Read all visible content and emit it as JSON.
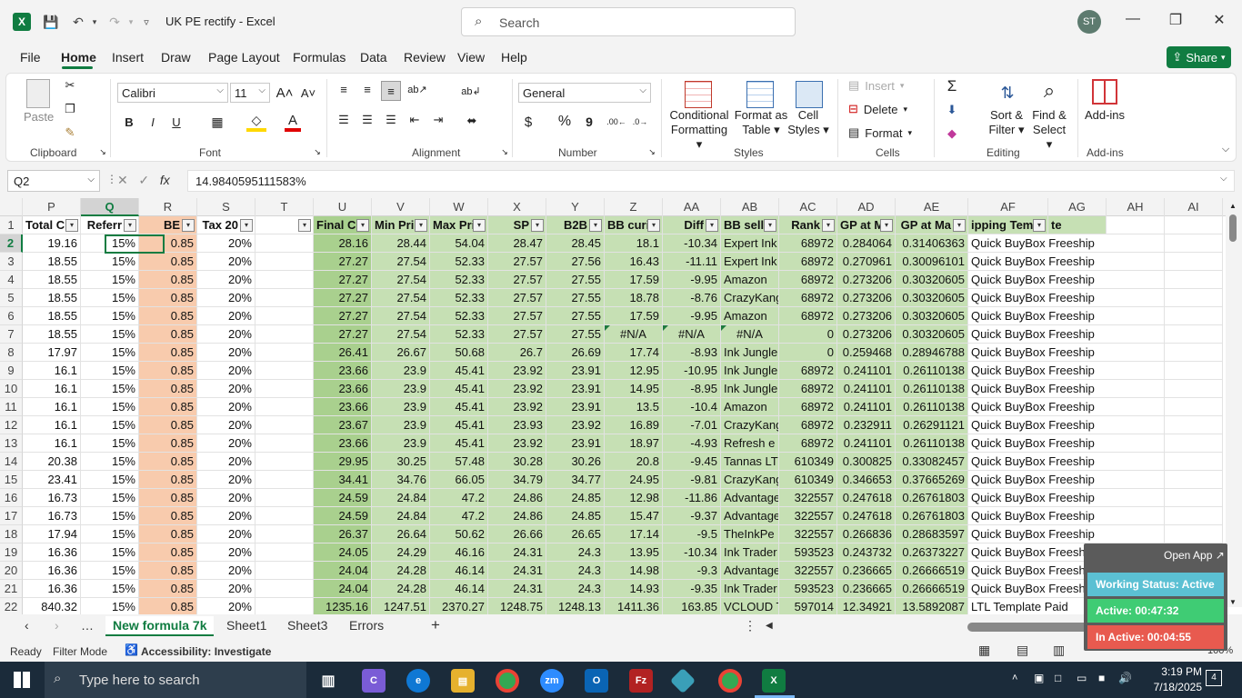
{
  "titlebar": {
    "doc_title": "UK PE rectify  -  Excel",
    "search_placeholder": "Search",
    "avatar": "ST"
  },
  "menu": [
    "File",
    "Home",
    "Insert",
    "Draw",
    "Page Layout",
    "Formulas",
    "Data",
    "Review",
    "View",
    "Help"
  ],
  "share_label": "Share",
  "ribbon": {
    "clipboard": {
      "label": "Clipboard",
      "paste": "Paste"
    },
    "font": {
      "label": "Font",
      "name": "Calibri",
      "size": "11",
      "bold": "B",
      "italic": "I",
      "underline": "U"
    },
    "alignment": {
      "label": "Alignment"
    },
    "number": {
      "label": "Number",
      "format": "General",
      "currency": "$",
      "percent": "%",
      "comma": "9"
    },
    "styles": {
      "label": "Styles",
      "conditional": "Conditional",
      "formatting": "Formatting",
      "format_as": "Format as",
      "table": "Table",
      "cell": "Cell",
      "styles": "Styles"
    },
    "cells": {
      "label": "Cells",
      "insert": "Insert",
      "delete": "Delete",
      "format": "Format"
    },
    "editing": {
      "label": "Editing",
      "sort": "Sort &",
      "filter": "Filter",
      "find": "Find &",
      "select": "Select"
    },
    "addins": {
      "label": "Add-ins",
      "addins": "Add-ins"
    }
  },
  "formula_bar": {
    "name_box": "Q2",
    "formula": "14.9840595111583%"
  },
  "columns": [
    "P",
    "Q",
    "R",
    "S",
    "T",
    "U",
    "V",
    "W",
    "X",
    "Y",
    "Z",
    "AA",
    "AB",
    "AC",
    "AD",
    "AE",
    "AF",
    "AG",
    "AH",
    "AI"
  ],
  "headers": [
    "Total C",
    "Referr",
    "BE",
    "Tax 20",
    "",
    "Final C",
    "Min Pri",
    "Max Pri",
    "SP",
    "B2B",
    "BB curi",
    "Diff",
    "BB sell",
    "Rank",
    "GP at M",
    "GP at Ma",
    "ipping Temp",
    "te",
    "",
    ""
  ],
  "rows": [
    {
      "n": "2",
      "v": [
        "19.16",
        "15%",
        "0.85",
        "20%",
        "",
        "28.16",
        "28.44",
        "54.04",
        "28.47",
        "28.45",
        "18.1",
        "-10.34",
        "Expert Ink",
        "68972",
        "0.284064",
        "0.31406363",
        "Quick BuyBox Freeship"
      ]
    },
    {
      "n": "3",
      "v": [
        "18.55",
        "15%",
        "0.85",
        "20%",
        "",
        "27.27",
        "27.54",
        "52.33",
        "27.57",
        "27.56",
        "16.43",
        "-11.11",
        "Expert Ink",
        "68972",
        "0.270961",
        "0.30096101",
        "Quick BuyBox Freeship"
      ]
    },
    {
      "n": "4",
      "v": [
        "18.55",
        "15%",
        "0.85",
        "20%",
        "",
        "27.27",
        "27.54",
        "52.33",
        "27.57",
        "27.55",
        "17.59",
        "-9.95",
        "Amazon",
        "68972",
        "0.273206",
        "0.30320605",
        "Quick BuyBox Freeship"
      ]
    },
    {
      "n": "5",
      "v": [
        "18.55",
        "15%",
        "0.85",
        "20%",
        "",
        "27.27",
        "27.54",
        "52.33",
        "27.57",
        "27.55",
        "18.78",
        "-8.76",
        "CrazyKang",
        "68972",
        "0.273206",
        "0.30320605",
        "Quick BuyBox Freeship"
      ]
    },
    {
      "n": "6",
      "v": [
        "18.55",
        "15%",
        "0.85",
        "20%",
        "",
        "27.27",
        "27.54",
        "52.33",
        "27.57",
        "27.55",
        "17.59",
        "-9.95",
        "Amazon",
        "68972",
        "0.273206",
        "0.30320605",
        "Quick BuyBox Freeship"
      ]
    },
    {
      "n": "7",
      "v": [
        "18.55",
        "15%",
        "0.85",
        "20%",
        "",
        "27.27",
        "27.54",
        "52.33",
        "27.57",
        "27.55",
        "#N/A",
        "#N/A",
        "#N/A",
        "0",
        "0.273206",
        "0.30320605",
        "Quick BuyBox Freeship"
      ]
    },
    {
      "n": "8",
      "v": [
        "17.97",
        "15%",
        "0.85",
        "20%",
        "",
        "26.41",
        "26.67",
        "50.68",
        "26.7",
        "26.69",
        "17.74",
        "-8.93",
        "Ink Jungle",
        "0",
        "0.259468",
        "0.28946788",
        "Quick BuyBox Freeship"
      ]
    },
    {
      "n": "9",
      "v": [
        "16.1",
        "15%",
        "0.85",
        "20%",
        "",
        "23.66",
        "23.9",
        "45.41",
        "23.92",
        "23.91",
        "12.95",
        "-10.95",
        "Ink Jungle",
        "68972",
        "0.241101",
        "0.26110138",
        "Quick BuyBox Freeship"
      ]
    },
    {
      "n": "10",
      "v": [
        "16.1",
        "15%",
        "0.85",
        "20%",
        "",
        "23.66",
        "23.9",
        "45.41",
        "23.92",
        "23.91",
        "14.95",
        "-8.95",
        "Ink Jungle",
        "68972",
        "0.241101",
        "0.26110138",
        "Quick BuyBox Freeship"
      ]
    },
    {
      "n": "11",
      "v": [
        "16.1",
        "15%",
        "0.85",
        "20%",
        "",
        "23.66",
        "23.9",
        "45.41",
        "23.92",
        "23.91",
        "13.5",
        "-10.4",
        "Amazon",
        "68972",
        "0.241101",
        "0.26110138",
        "Quick BuyBox Freeship"
      ]
    },
    {
      "n": "12",
      "v": [
        "16.1",
        "15%",
        "0.85",
        "20%",
        "",
        "23.67",
        "23.9",
        "45.41",
        "23.93",
        "23.92",
        "16.89",
        "-7.01",
        "CrazyKang",
        "68972",
        "0.232911",
        "0.26291121",
        "Quick BuyBox Freeship"
      ]
    },
    {
      "n": "13",
      "v": [
        "16.1",
        "15%",
        "0.85",
        "20%",
        "",
        "23.66",
        "23.9",
        "45.41",
        "23.92",
        "23.91",
        "18.97",
        "-4.93",
        "Refresh e",
        "68972",
        "0.241101",
        "0.26110138",
        "Quick BuyBox Freeship"
      ]
    },
    {
      "n": "14",
      "v": [
        "20.38",
        "15%",
        "0.85",
        "20%",
        "",
        "29.95",
        "30.25",
        "57.48",
        "30.28",
        "30.26",
        "20.8",
        "-9.45",
        "Tannas LT",
        "610349",
        "0.300825",
        "0.33082457",
        "Quick BuyBox Freeship"
      ]
    },
    {
      "n": "15",
      "v": [
        "23.41",
        "15%",
        "0.85",
        "20%",
        "",
        "34.41",
        "34.76",
        "66.05",
        "34.79",
        "34.77",
        "24.95",
        "-9.81",
        "CrazyKang",
        "610349",
        "0.346653",
        "0.37665269",
        "Quick BuyBox Freeship"
      ]
    },
    {
      "n": "16",
      "v": [
        "16.73",
        "15%",
        "0.85",
        "20%",
        "",
        "24.59",
        "24.84",
        "47.2",
        "24.86",
        "24.85",
        "12.98",
        "-11.86",
        "Advantage",
        "322557",
        "0.247618",
        "0.26761803",
        "Quick BuyBox Freeship"
      ]
    },
    {
      "n": "17",
      "v": [
        "16.73",
        "15%",
        "0.85",
        "20%",
        "",
        "24.59",
        "24.84",
        "47.2",
        "24.86",
        "24.85",
        "15.47",
        "-9.37",
        "Advantage",
        "322557",
        "0.247618",
        "0.26761803",
        "Quick BuyBox Freeship"
      ]
    },
    {
      "n": "18",
      "v": [
        "17.94",
        "15%",
        "0.85",
        "20%",
        "",
        "26.37",
        "26.64",
        "50.62",
        "26.66",
        "26.65",
        "17.14",
        "-9.5",
        "TheInkPe",
        "322557",
        "0.266836",
        "0.28683597",
        "Quick BuyBox Freeship"
      ]
    },
    {
      "n": "19",
      "v": [
        "16.36",
        "15%",
        "0.85",
        "20%",
        "",
        "24.05",
        "24.29",
        "46.16",
        "24.31",
        "24.3",
        "13.95",
        "-10.34",
        "Ink Trader",
        "593523",
        "0.243732",
        "0.26373227",
        "Quick BuyBox Freeship"
      ]
    },
    {
      "n": "20",
      "v": [
        "16.36",
        "15%",
        "0.85",
        "20%",
        "",
        "24.04",
        "24.28",
        "46.14",
        "24.31",
        "24.3",
        "14.98",
        "-9.3",
        "Advantage",
        "322557",
        "0.236665",
        "0.26666519",
        "Quick BuyBox Freeship"
      ]
    },
    {
      "n": "21",
      "v": [
        "16.36",
        "15%",
        "0.85",
        "20%",
        "",
        "24.04",
        "24.28",
        "46.14",
        "24.31",
        "24.3",
        "14.93",
        "-9.35",
        "Ink Trader",
        "593523",
        "0.236665",
        "0.26666519",
        "Quick BuyBox Freeship"
      ]
    },
    {
      "n": "22",
      "v": [
        "840.32",
        "15%",
        "0.85",
        "20%",
        "",
        "1235.16",
        "1247.51",
        "2370.27",
        "1248.75",
        "1248.13",
        "1411.36",
        "163.85",
        "VCLOUD T",
        "597014",
        "12.34921",
        "13.5892087",
        "LTL Template Paid"
      ]
    }
  ],
  "sheets": [
    "New formula 7k",
    "Sheet1",
    "Sheet3",
    "Errors"
  ],
  "status": {
    "ready": "Ready",
    "filter_mode": "Filter Mode",
    "accessibility": "Accessibility: Investigate",
    "zoom": "100%"
  },
  "overlay": {
    "open_app": "Open App",
    "working": "Working Status: Active",
    "active": "Active: 00:47:32",
    "inactive": "In Active: 00:04:55"
  },
  "taskbar": {
    "search": "Type here to search",
    "time": "3:19 PM",
    "date": "7/18/2025",
    "notif": "4"
  },
  "colors": {
    "green_fill": "#c6e0b4",
    "dark_green_fill": "#a9d08e",
    "orange_fill": "#f8cbad",
    "accent": "#107c41"
  }
}
